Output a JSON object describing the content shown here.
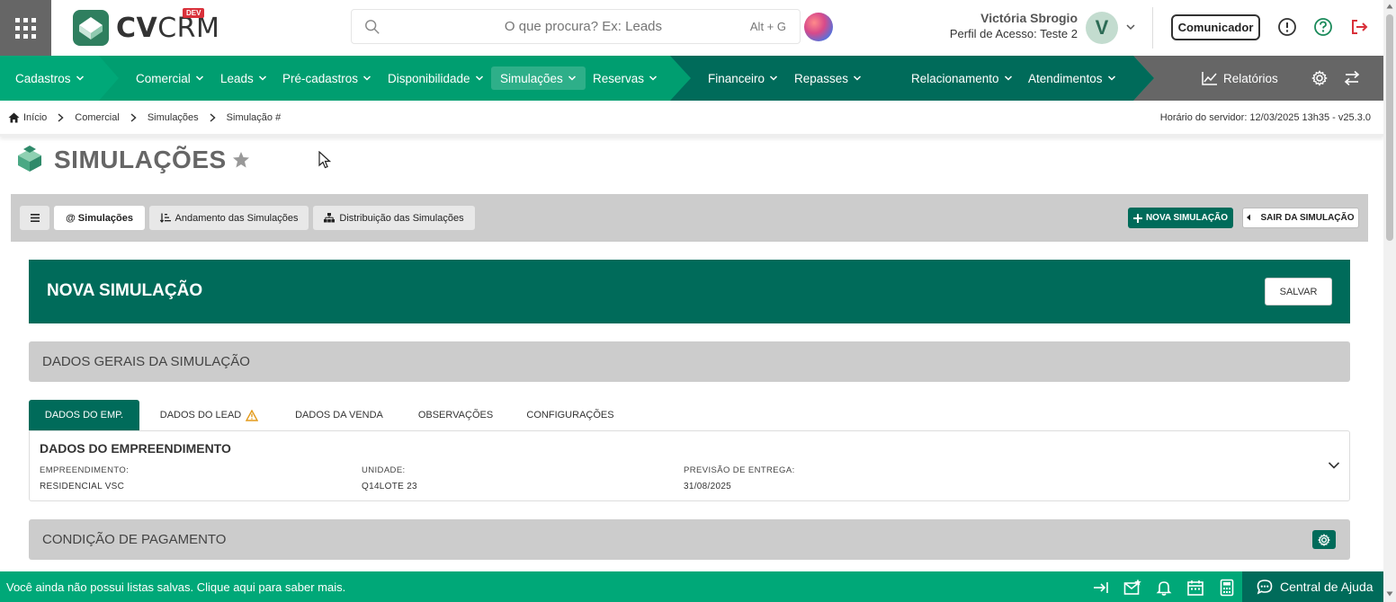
{
  "header": {
    "logo_text_bold": "CV",
    "logo_text_light": "CRM",
    "logo_badge": "DEV",
    "search_placeholder": "O que procura? Ex: Leads",
    "search_shortcut": "Alt + G",
    "user_name": "Victória Sbrogio",
    "user_profile": "Perfil de Acesso: Teste 2",
    "avatar_initial": "V",
    "comunicador_label": "Comunicador"
  },
  "nav": {
    "items": [
      {
        "label": "Cadastros"
      },
      {
        "label": "Comercial"
      },
      {
        "label": "Leads"
      },
      {
        "label": "Pré-cadastros"
      },
      {
        "label": "Disponibilidade"
      },
      {
        "label": "Simulações"
      },
      {
        "label": "Reservas"
      },
      {
        "label": "Financeiro"
      },
      {
        "label": "Repasses"
      },
      {
        "label": "Relacionamento"
      },
      {
        "label": "Atendimentos"
      }
    ],
    "relatorios_label": "Relatórios",
    "active": "Simulações"
  },
  "breadcrumb": {
    "items": [
      "Início",
      "Comercial",
      "Simulações",
      "Simulação #"
    ],
    "server_time": "Horário do servidor: 12/03/2025 13h35 - v25.3.0"
  },
  "page": {
    "title": "SIMULAÇÕES"
  },
  "toolbar": {
    "simulacoes_label": "Simulações",
    "andamento_label": "Andamento das Simulações",
    "distribuicao_label": "Distribuição das Simulações",
    "nova_label": "NOVA SIMULAÇÃO",
    "sair_label": "SAIR DA SIMULAÇÃO"
  },
  "banner": {
    "title": "NOVA SIMULAÇÃO",
    "salvar_label": "SALVAR"
  },
  "sections": {
    "dados_gerais": "DADOS GERAIS DA SIMULAÇÃO",
    "condicao": "CONDIÇÃO DE PAGAMENTO"
  },
  "tabs": {
    "items": [
      {
        "label": "DADOS DO EMP."
      },
      {
        "label": "DADOS DO LEAD"
      },
      {
        "label": "DADOS DA VENDA"
      },
      {
        "label": "OBSERVAÇÕES"
      },
      {
        "label": "CONFIGURAÇÕES"
      }
    ],
    "active": "DADOS DO EMP."
  },
  "empreendimento": {
    "heading": "DADOS DO EMPREENDIMENTO",
    "fields": [
      {
        "label": "EMPREENDIMENTO:",
        "value": "RESIDENCIAL VSC"
      },
      {
        "label": "UNIDADE:",
        "value": "Q14LOTE 23"
      },
      {
        "label": "PREVISÃO DE ENTREGA:",
        "value": "31/08/2025"
      }
    ]
  },
  "footer": {
    "message": "Você ainda não possui listas salvas. Clique aqui para saber mais.",
    "help_label": "Central de Ajuda"
  },
  "colors": {
    "brand_dark": "#006b5a",
    "brand_green": "#00a878",
    "relatorios_bg": "#666666"
  }
}
